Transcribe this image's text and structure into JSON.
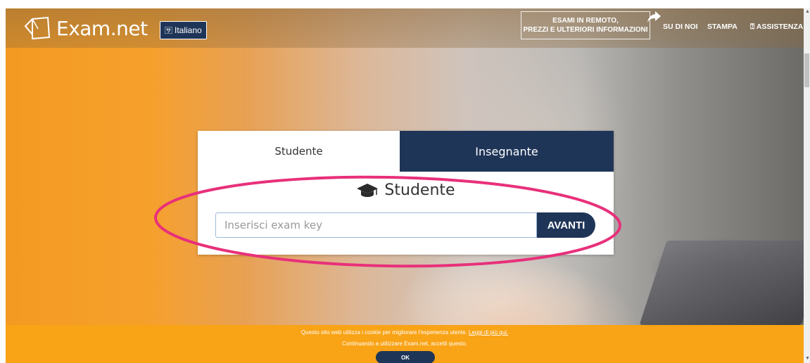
{
  "header": {
    "logo_text": "Exam.net",
    "language_label": "Italiano",
    "promo_line1": "ESAMI IN REMOTO,",
    "promo_line2": "PREZZI E ULTERIORI INFORMAZIONI",
    "nav": [
      {
        "label": "SU DI NOI"
      },
      {
        "label": "STAMPA"
      },
      {
        "label": "ASSISTENZA",
        "icon": "help-circle-icon"
      }
    ]
  },
  "card": {
    "tabs": [
      {
        "label": "Studente",
        "active": true
      },
      {
        "label": "Insegnante",
        "active": false
      }
    ],
    "title": "Studente",
    "title_icon": "graduation-cap-icon",
    "input_placeholder": "Inserisci exam key",
    "input_value": "",
    "submit_label": "AVANTI"
  },
  "cookie_banner": {
    "text1": "Questo sito web utilizza i cookie per migliorare l'esperienza utente.",
    "link": "Leggi di più qui.",
    "text2": "Continuando a utilizzare Exam.net, accetti questo.",
    "ok_label": "OK"
  },
  "colors": {
    "navy": "#1f3558",
    "orange": "#f9a316",
    "annotation": "#e8307a"
  }
}
